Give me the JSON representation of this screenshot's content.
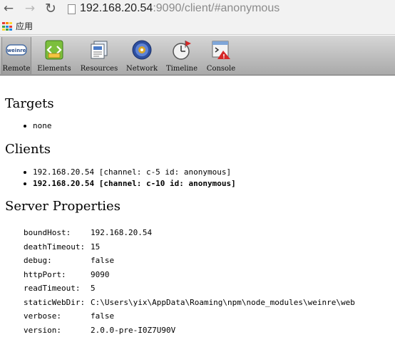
{
  "browser": {
    "url_host": "192.168.20.54",
    "url_path": ":9090/client/#anonymous",
    "apps_label": "应用"
  },
  "toolbar": {
    "items": [
      {
        "label": "Remote",
        "icon": "weinre-logo-icon",
        "selected": true
      },
      {
        "label": "Elements",
        "icon": "elements-icon"
      },
      {
        "label": "Resources",
        "icon": "resources-icon"
      },
      {
        "label": "Network",
        "icon": "network-icon"
      },
      {
        "label": "Timeline",
        "icon": "timeline-icon"
      },
      {
        "label": "Console",
        "icon": "console-icon"
      }
    ]
  },
  "targets": {
    "heading": "Targets",
    "items": [
      "none"
    ]
  },
  "clients": {
    "heading": "Clients",
    "items": [
      "192.168.20.54 [channel: c-5 id: anonymous]",
      "192.168.20.54 [channel: c-10 id: anonymous]"
    ]
  },
  "server": {
    "heading": "Server Properties",
    "props": [
      {
        "key": "boundHost:",
        "value": "192.168.20.54"
      },
      {
        "key": "deathTimeout:",
        "value": "15"
      },
      {
        "key": "debug:",
        "value": "false"
      },
      {
        "key": "httpPort:",
        "value": "9090"
      },
      {
        "key": "readTimeout:",
        "value": "5"
      },
      {
        "key": "staticWebDir:",
        "value": "C:\\Users\\yix\\AppData\\Roaming\\npm\\node_modules\\weinre\\web"
      },
      {
        "key": "verbose:",
        "value": "false"
      },
      {
        "key": "version:",
        "value": "2.0.0-pre-I0Z7U90V"
      }
    ]
  }
}
